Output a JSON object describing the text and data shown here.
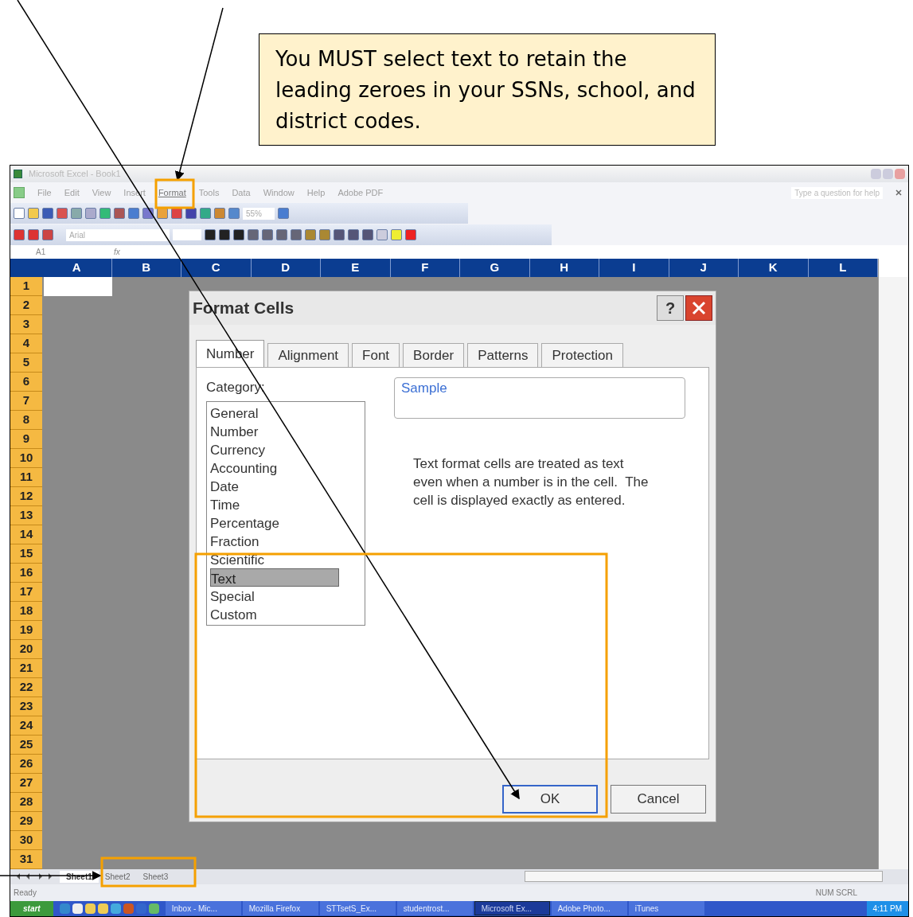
{
  "callout": {
    "text": "You MUST select text to retain the leading zeroes in your SSNs, school, and district codes."
  },
  "window": {
    "title": "Microsoft Excel - Book1"
  },
  "menu": [
    {
      "label": "File",
      "highlighted": false
    },
    {
      "label": "Edit",
      "highlighted": false
    },
    {
      "label": "View",
      "highlighted": false
    },
    {
      "label": "Insert",
      "highlighted": false
    },
    {
      "label": "Format",
      "highlighted": true
    },
    {
      "label": "Tools",
      "highlighted": false
    },
    {
      "label": "Data",
      "highlighted": false
    },
    {
      "label": "Window",
      "highlighted": false
    },
    {
      "label": "Help",
      "highlighted": false
    },
    {
      "label": "Adobe PDF",
      "highlighted": false
    }
  ],
  "help_box": {
    "placeholder": "Type a question for help"
  },
  "toolbar": {
    "zoom": "55%",
    "font": "Arial"
  },
  "formula_bar": {
    "name_box": "A1",
    "fx": "fx"
  },
  "columns": [
    "A",
    "B",
    "C",
    "D",
    "E",
    "F",
    "G",
    "H",
    "I",
    "J",
    "K",
    "L"
  ],
  "rows": [
    "1",
    "2",
    "3",
    "4",
    "5",
    "6",
    "7",
    "8",
    "9",
    "10",
    "11",
    "12",
    "13",
    "14",
    "15",
    "16",
    "17",
    "18",
    "19",
    "20",
    "21",
    "22",
    "23",
    "24",
    "25",
    "26",
    "27",
    "28",
    "29",
    "30",
    "31"
  ],
  "dialog": {
    "title": "Format Cells",
    "help": "?",
    "tabs": [
      {
        "label": "Number",
        "selected": true
      },
      {
        "label": "Alignment",
        "selected": false
      },
      {
        "label": "Font",
        "selected": false
      },
      {
        "label": "Border",
        "selected": false
      },
      {
        "label": "Patterns",
        "selected": false
      },
      {
        "label": "Protection",
        "selected": false
      }
    ],
    "category_label": "Category:",
    "categories": [
      {
        "label": "General",
        "selected": false
      },
      {
        "label": "Number",
        "selected": false
      },
      {
        "label": "Currency",
        "selected": false
      },
      {
        "label": "Accounting",
        "selected": false
      },
      {
        "label": "Date",
        "selected": false
      },
      {
        "label": "Time",
        "selected": false
      },
      {
        "label": "Percentage",
        "selected": false
      },
      {
        "label": "Fraction",
        "selected": false
      },
      {
        "label": "Scientific",
        "selected": false
      },
      {
        "label": "Text",
        "selected": true
      },
      {
        "label": "Special",
        "selected": false
      },
      {
        "label": "Custom",
        "selected": false
      }
    ],
    "sample_label": "Sample",
    "description": "Text format cells are treated as text even when a number is in the cell.  The cell is displayed exactly as entered.",
    "buttons": [
      {
        "label": "OK",
        "kind": "default"
      },
      {
        "label": "Cancel",
        "kind": "normal"
      }
    ]
  },
  "sheet_tabs": [
    {
      "label": "Sheet1",
      "selected": true
    },
    {
      "label": "Sheet2",
      "selected": false
    },
    {
      "label": "Sheet3",
      "selected": false
    }
  ],
  "status_bar": {
    "left": "Ready",
    "right": "NUM SCRL"
  },
  "taskbar": {
    "start": "start",
    "items": [
      {
        "label": "Inbox - Mic...",
        "selected": false
      },
      {
        "label": "Mozilla Firefox",
        "selected": false
      },
      {
        "label": "STTsetS_Ex...",
        "selected": false
      },
      {
        "label": "studentrost...",
        "selected": false
      },
      {
        "label": "Microsoft Ex...",
        "selected": true
      },
      {
        "label": "Adobe Photo...",
        "selected": false
      },
      {
        "label": "iTunes",
        "selected": false
      }
    ],
    "clock": "4:11 PM"
  }
}
